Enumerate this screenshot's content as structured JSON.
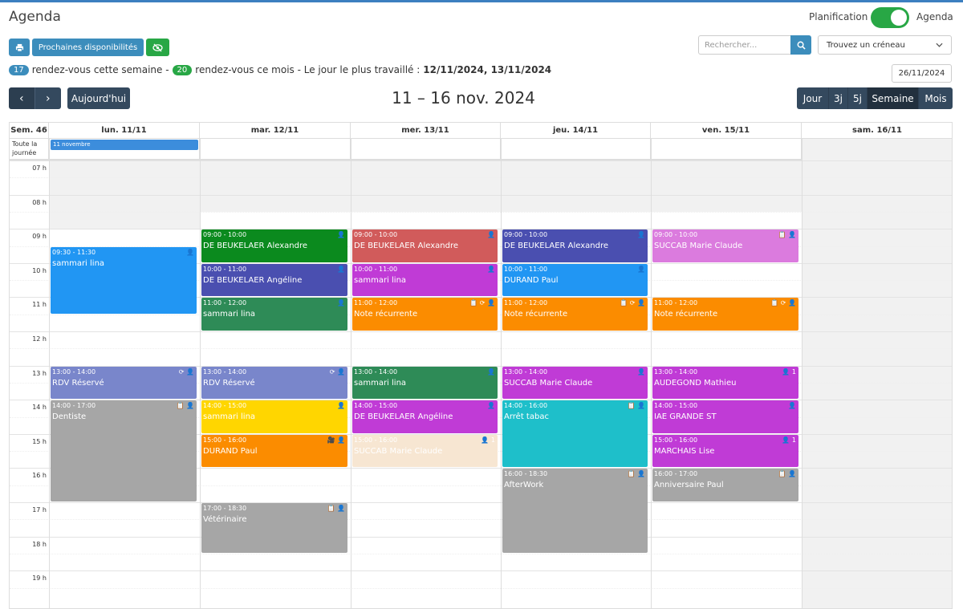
{
  "app": {
    "title": "Agenda",
    "toggle_left_label": "Planification",
    "toggle_right_label": "Agenda",
    "toggle_color": "#28a745"
  },
  "toolbar": {
    "print_icon": "print-icon",
    "next_slots_label": "Prochaines disponibilités",
    "hide_icon": "eye-slash-icon",
    "search_placeholder": "Rechercher...",
    "search_icon": "search-icon",
    "slot_select_value": "Trouvez un créneau",
    "date_value": "26/11/2024"
  },
  "stats": {
    "week_count": "17",
    "week_text": "rendez-vous cette semaine -",
    "month_count": "20",
    "month_text": "rendez-vous ce mois - Le jour le plus travaillé :",
    "busiest_days": "12/11/2024, 13/11/2024"
  },
  "nav": {
    "prev": "‹",
    "next": "›",
    "today_label": "Aujourd'hui",
    "range_title": "11 – 16 nov. 2024",
    "views": [
      "Jour",
      "3j",
      "5j",
      "Semaine",
      "Mois"
    ],
    "active_view": "Semaine"
  },
  "calendar": {
    "week_label": "Sem. 46",
    "allday_label": "Toute la journée",
    "days": [
      "lun. 11/11",
      "mar. 12/11",
      "mer. 13/11",
      "jeu. 14/11",
      "ven. 15/11",
      "sam. 16/11"
    ],
    "hours": [
      "07 h",
      "08 h",
      "09 h",
      "10 h",
      "11 h",
      "12 h",
      "13 h",
      "14 h",
      "15 h",
      "16 h",
      "17 h",
      "18 h",
      "19 h"
    ],
    "allday_events": [
      {
        "day": 0,
        "title": "11 novembre"
      }
    ],
    "events": [
      {
        "day": 0,
        "start": 9.5,
        "end": 11.5,
        "time": "09:30 - 11:30",
        "title": "sammari lina",
        "color": "#2196f3",
        "icons": "👤"
      },
      {
        "day": 0,
        "start": 13,
        "end": 14,
        "time": "13:00 - 14:00",
        "title": "RDV Réservé",
        "color": "#7986cb",
        "icons": "⟳ 👤"
      },
      {
        "day": 0,
        "start": 14,
        "end": 17,
        "time": "14:00 - 17:00",
        "title": "Dentiste",
        "color": "#a6a6a6",
        "icons": "📋 👤"
      },
      {
        "day": 1,
        "start": 9,
        "end": 10,
        "time": "09:00 - 10:00",
        "title": "DE BEUKELAER Alexandre",
        "color": "#0b8a1e",
        "icons": "👤"
      },
      {
        "day": 1,
        "start": 10,
        "end": 11,
        "time": "10:00 - 11:00",
        "title": "DE BEUKELAER Angéline",
        "color": "#4a4fb0",
        "icons": "👤"
      },
      {
        "day": 1,
        "start": 11,
        "end": 12,
        "time": "11:00 - 12:00",
        "title": "sammari lina",
        "color": "#2e8b57",
        "icons": "👤"
      },
      {
        "day": 1,
        "start": 13,
        "end": 14,
        "time": "13:00 - 14:00",
        "title": "RDV Réservé",
        "color": "#7986cb",
        "icons": "⟳ 👤"
      },
      {
        "day": 1,
        "start": 14,
        "end": 15,
        "time": "14:00 - 15:00",
        "title": "sammari lina",
        "color": "#ffd600",
        "icons": "👤"
      },
      {
        "day": 1,
        "start": 15,
        "end": 16,
        "time": "15:00 - 16:00",
        "title": "DURAND Paul",
        "color": "#fb8c00",
        "icons": "🎥 👤"
      },
      {
        "day": 1,
        "start": 17,
        "end": 18.5,
        "time": "17:00 - 18:30",
        "title": "Vétérinaire",
        "color": "#a6a6a6",
        "icons": "📋 👤"
      },
      {
        "day": 2,
        "start": 9,
        "end": 10,
        "time": "09:00 - 10:00",
        "title": "DE BEUKELAER Alexandre",
        "color": "#d15b5b",
        "icons": "👤"
      },
      {
        "day": 2,
        "start": 10,
        "end": 11,
        "time": "10:00 - 11:00",
        "title": "sammari lina",
        "color": "#c03bd6",
        "icons": "👤"
      },
      {
        "day": 2,
        "start": 11,
        "end": 12,
        "time": "11:00 - 12:00",
        "title": "Note récurrente",
        "color": "#fb8c00",
        "icons": "📋 ⟳ 👤"
      },
      {
        "day": 2,
        "start": 13,
        "end": 14,
        "time": "13:00 - 14:00",
        "title": "sammari lina",
        "color": "#2e8b57",
        "icons": "👤"
      },
      {
        "day": 2,
        "start": 14,
        "end": 15,
        "time": "14:00 - 15:00",
        "title": "DE BEUKELAER Angéline",
        "color": "#c03bd6",
        "icons": "👤"
      },
      {
        "day": 2,
        "start": 15,
        "end": 16,
        "time": "15:00 - 16:00",
        "title": "SUCCAB Marie Claude",
        "color": "#f7e6d2",
        "icons": "👤 1"
      },
      {
        "day": 3,
        "start": 9,
        "end": 10,
        "time": "09:00 - 10:00",
        "title": "DE BEUKELAER Alexandre",
        "color": "#4a4fb0",
        "icons": "👤"
      },
      {
        "day": 3,
        "start": 10,
        "end": 11,
        "time": "10:00 - 11:00",
        "title": "DURAND Paul",
        "color": "#2196f3",
        "icons": "👤"
      },
      {
        "day": 3,
        "start": 11,
        "end": 12,
        "time": "11:00 - 12:00",
        "title": "Note récurrente",
        "color": "#fb8c00",
        "icons": "📋 ⟳ 👤"
      },
      {
        "day": 3,
        "start": 13,
        "end": 14,
        "time": "13:00 - 14:00",
        "title": "SUCCAB Marie Claude",
        "color": "#c03bd6",
        "icons": "👤"
      },
      {
        "day": 3,
        "start": 14,
        "end": 16,
        "time": "14:00 - 16:00",
        "title": "Arrêt tabac",
        "color": "#1ebfca",
        "icons": "📋 👤"
      },
      {
        "day": 3,
        "start": 16,
        "end": 18.5,
        "time": "16:00 - 18:30",
        "title": "AfterWork",
        "color": "#a6a6a6",
        "icons": "📋 👤"
      },
      {
        "day": 4,
        "start": 9,
        "end": 10,
        "time": "09:00 - 10:00",
        "title": "SUCCAB Marie Claude",
        "color": "#db7bde",
        "icons": "📋 👤"
      },
      {
        "day": 4,
        "start": 11,
        "end": 12,
        "time": "11:00 - 12:00",
        "title": "Note récurrente",
        "color": "#fb8c00",
        "icons": "📋 ⟳ 👤"
      },
      {
        "day": 4,
        "start": 13,
        "end": 14,
        "time": "13:00 - 14:00",
        "title": "AUDEGOND Mathieu",
        "color": "#c03bd6",
        "icons": "👤 1"
      },
      {
        "day": 4,
        "start": 14,
        "end": 15,
        "time": "14:00 - 15:00",
        "title": "IAE GRANDE ST",
        "color": "#c03bd6",
        "icons": "👤"
      },
      {
        "day": 4,
        "start": 15,
        "end": 16,
        "time": "15:00 - 16:00",
        "title": "MARCHAIS Lise",
        "color": "#c03bd6",
        "icons": "👤 1"
      },
      {
        "day": 4,
        "start": 16,
        "end": 17,
        "time": "16:00 - 17:00",
        "title": "Anniversaire Paul",
        "color": "#a6a6a6",
        "icons": "📋 👤"
      }
    ]
  }
}
